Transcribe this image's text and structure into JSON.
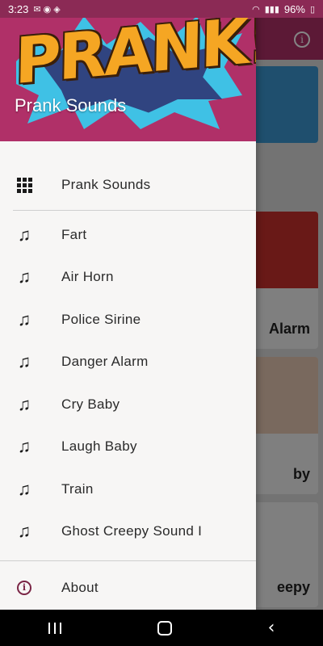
{
  "status_bar": {
    "time": "3:23",
    "battery": "96%"
  },
  "background_cards": [
    {
      "label": ""
    },
    {
      "label": "Alarm"
    },
    {
      "label": "by"
    },
    {
      "label": "eepy"
    }
  ],
  "drawer": {
    "header": {
      "logo": "PRANK!",
      "title": "Prank Sounds"
    },
    "top_item": {
      "label": "Prank Sounds",
      "icon": "grid-icon"
    },
    "sounds": [
      {
        "label": "Fart",
        "icon": "music-note-icon"
      },
      {
        "label": "Air Horn",
        "icon": "music-note-icon"
      },
      {
        "label": "Police Sirine",
        "icon": "music-note-icon"
      },
      {
        "label": "Danger Alarm",
        "icon": "music-note-icon"
      },
      {
        "label": "Cry Baby",
        "icon": "music-note-icon"
      },
      {
        "label": "Laugh Baby",
        "icon": "music-note-icon"
      },
      {
        "label": "Train",
        "icon": "music-note-icon"
      },
      {
        "label": "Ghost Creepy Sound I",
        "icon": "music-note-icon"
      }
    ],
    "about": {
      "label": "About",
      "icon": "info-icon"
    }
  },
  "colors": {
    "header_bg": "#b03068",
    "logo": "#f5a623",
    "burst": "#3fc1e5",
    "drawer_bg": "#f7f6f5"
  }
}
